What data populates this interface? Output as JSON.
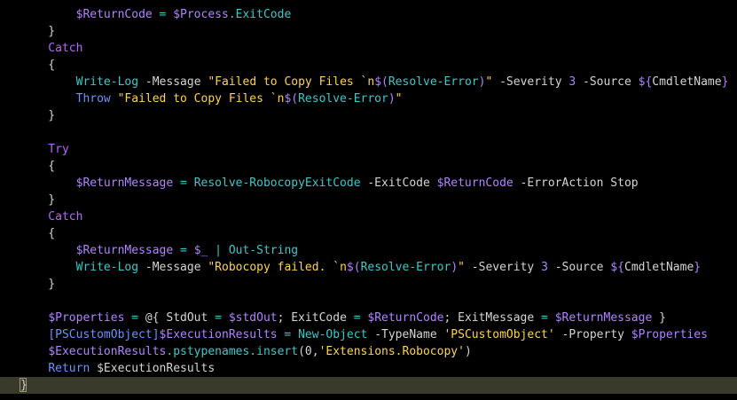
{
  "editor": {
    "language": "PowerShell",
    "theme": {
      "background": "#000000",
      "current_line": "#3a3a2a",
      "colors": {
        "plain": "#d4d4d4",
        "var": "#b083ff",
        "key": "#6b93ff",
        "kw": "#b466ff",
        "cmd": "#3cc8c8",
        "op": "#3cc8c8",
        "str": "#ffd34a",
        "num": "#b083ff"
      }
    },
    "lines": [
      {
        "tokens": [
          [
            "plain",
            "        "
          ],
          [
            "var",
            "$ReturnCode"
          ],
          [
            "op",
            " = "
          ],
          [
            "var",
            "$Process"
          ],
          [
            "op",
            "."
          ],
          [
            "cmd",
            "ExitCode"
          ]
        ]
      },
      {
        "tokens": [
          [
            "plain",
            "    }"
          ]
        ]
      },
      {
        "tokens": [
          [
            "kw",
            "    Catch"
          ]
        ]
      },
      {
        "tokens": [
          [
            "plain",
            "    {"
          ]
        ]
      },
      {
        "tokens": [
          [
            "plain",
            "        "
          ],
          [
            "cmd",
            "Write-Log"
          ],
          [
            "plain",
            " -Message "
          ],
          [
            "str",
            "\"Failed to Copy Files `n"
          ],
          [
            "var",
            "$("
          ],
          [
            "cmd",
            "Resolve-Error"
          ],
          [
            "var",
            ")"
          ],
          [
            "str",
            "\""
          ],
          [
            "plain",
            " -Severity "
          ],
          [
            "num",
            "3"
          ],
          [
            "plain",
            " -Source "
          ],
          [
            "var",
            "${"
          ],
          [
            "plain",
            "CmdletName"
          ],
          [
            "var",
            "}"
          ]
        ]
      },
      {
        "tokens": [
          [
            "plain",
            "        "
          ],
          [
            "key",
            "Throw "
          ],
          [
            "str",
            "\"Failed to Copy Files `n"
          ],
          [
            "var",
            "$("
          ],
          [
            "cmd",
            "Resolve-Error"
          ],
          [
            "var",
            ")"
          ],
          [
            "str",
            "\""
          ]
        ]
      },
      {
        "tokens": [
          [
            "plain",
            "    }"
          ]
        ]
      },
      {
        "tokens": [
          [
            "plain",
            ""
          ]
        ]
      },
      {
        "tokens": [
          [
            "kw",
            "    Try"
          ]
        ]
      },
      {
        "tokens": [
          [
            "plain",
            "    {"
          ]
        ]
      },
      {
        "tokens": [
          [
            "plain",
            "        "
          ],
          [
            "var",
            "$ReturnMessage"
          ],
          [
            "op",
            " = "
          ],
          [
            "cmd",
            "Resolve-RobocopyExitCode"
          ],
          [
            "plain",
            " -ExitCode "
          ],
          [
            "var",
            "$ReturnCode"
          ],
          [
            "plain",
            " -ErrorAction Stop"
          ]
        ]
      },
      {
        "tokens": [
          [
            "plain",
            "    }"
          ]
        ]
      },
      {
        "tokens": [
          [
            "kw",
            "    Catch"
          ]
        ]
      },
      {
        "tokens": [
          [
            "plain",
            "    {"
          ]
        ]
      },
      {
        "tokens": [
          [
            "plain",
            "        "
          ],
          [
            "var",
            "$ReturnMessage"
          ],
          [
            "op",
            " = "
          ],
          [
            "var",
            "$_"
          ],
          [
            "op",
            " | "
          ],
          [
            "cmd",
            "Out-String"
          ]
        ]
      },
      {
        "tokens": [
          [
            "plain",
            "        "
          ],
          [
            "cmd",
            "Write-Log"
          ],
          [
            "plain",
            " -Message "
          ],
          [
            "str",
            "\"Robocopy failed. `n"
          ],
          [
            "var",
            "$("
          ],
          [
            "cmd",
            "Resolve-Error"
          ],
          [
            "var",
            ")"
          ],
          [
            "str",
            "\""
          ],
          [
            "plain",
            " -Severity "
          ],
          [
            "num",
            "3"
          ],
          [
            "plain",
            " -Source "
          ],
          [
            "var",
            "${"
          ],
          [
            "plain",
            "CmdletName"
          ],
          [
            "var",
            "}"
          ]
        ]
      },
      {
        "tokens": [
          [
            "plain",
            "    }"
          ]
        ]
      },
      {
        "tokens": [
          [
            "plain",
            ""
          ]
        ]
      },
      {
        "tokens": [
          [
            "plain",
            "    "
          ],
          [
            "var",
            "$Properties"
          ],
          [
            "op",
            " = "
          ],
          [
            "plain",
            "@{ StdOut "
          ],
          [
            "op",
            "= "
          ],
          [
            "var",
            "$stdOut"
          ],
          [
            "plain",
            "; ExitCode "
          ],
          [
            "op",
            "= "
          ],
          [
            "var",
            "$ReturnCode"
          ],
          [
            "plain",
            "; ExitMessage "
          ],
          [
            "op",
            "= "
          ],
          [
            "var",
            "$ReturnMessage"
          ],
          [
            "plain",
            " }"
          ]
        ]
      },
      {
        "tokens": [
          [
            "plain",
            "    "
          ],
          [
            "key",
            "[PSCustomObject]"
          ],
          [
            "var",
            "$ExecutionResults"
          ],
          [
            "op",
            " = "
          ],
          [
            "cmd",
            "New-Object"
          ],
          [
            "plain",
            " -TypeName "
          ],
          [
            "str",
            "'PSCustomObject'"
          ],
          [
            "plain",
            " -Property "
          ],
          [
            "var",
            "$Properties"
          ]
        ]
      },
      {
        "tokens": [
          [
            "plain",
            "    "
          ],
          [
            "var",
            "$ExecutionResults"
          ],
          [
            "op",
            "."
          ],
          [
            "cmd",
            "pstypenames"
          ],
          [
            "op",
            "."
          ],
          [
            "cmd",
            "insert"
          ],
          [
            "plain",
            "(0,"
          ],
          [
            "str",
            "'Extensions.Robocopy'"
          ],
          [
            "plain",
            ")"
          ]
        ]
      },
      {
        "tokens": [
          [
            "plain",
            "    "
          ],
          [
            "key",
            "Return"
          ],
          [
            "plain",
            " $ExecutionResults"
          ]
        ]
      },
      {
        "tokens": [
          [
            "plain",
            "}"
          ]
        ],
        "current": true
      }
    ]
  }
}
